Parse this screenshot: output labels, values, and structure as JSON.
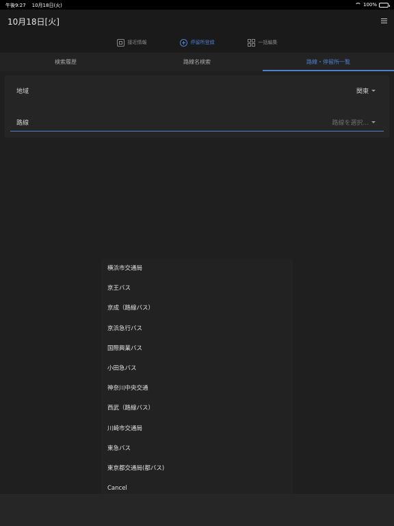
{
  "statusbar": {
    "time": "午後9:27",
    "date": "10月18日(火)",
    "battery": "100%"
  },
  "header": {
    "title": "10月18日[火]",
    "menu_icon": "hamburger-icon"
  },
  "segments": [
    {
      "label": "接近情報",
      "icon": "bus-stop-icon",
      "active": false
    },
    {
      "label": "停留所登録",
      "icon": "add-circle-icon",
      "active": true
    },
    {
      "label": "一括編集",
      "icon": "grid-icon",
      "active": false
    }
  ],
  "tabs": [
    {
      "label": "検索履歴",
      "active": false
    },
    {
      "label": "路線名検索",
      "active": false
    },
    {
      "label": "路線・停留所一覧",
      "active": true
    }
  ],
  "form": {
    "region_label": "地域",
    "region_value": "関東",
    "route_label": "路線",
    "route_placeholder": "路線を選択..."
  },
  "picker": {
    "items": [
      "横浜市交通局",
      "京王バス",
      "京成（路線バス）",
      "京浜急行バス",
      "国際興業バス",
      "小田急バス",
      "神奈川中央交通",
      "西武（路線バス）",
      "川崎市交通局",
      "東急バス",
      "東京都交通局(都バス)",
      "Cancel"
    ]
  },
  "colors": {
    "accent": "#4f7fd0",
    "background": "#1f1f1f"
  }
}
